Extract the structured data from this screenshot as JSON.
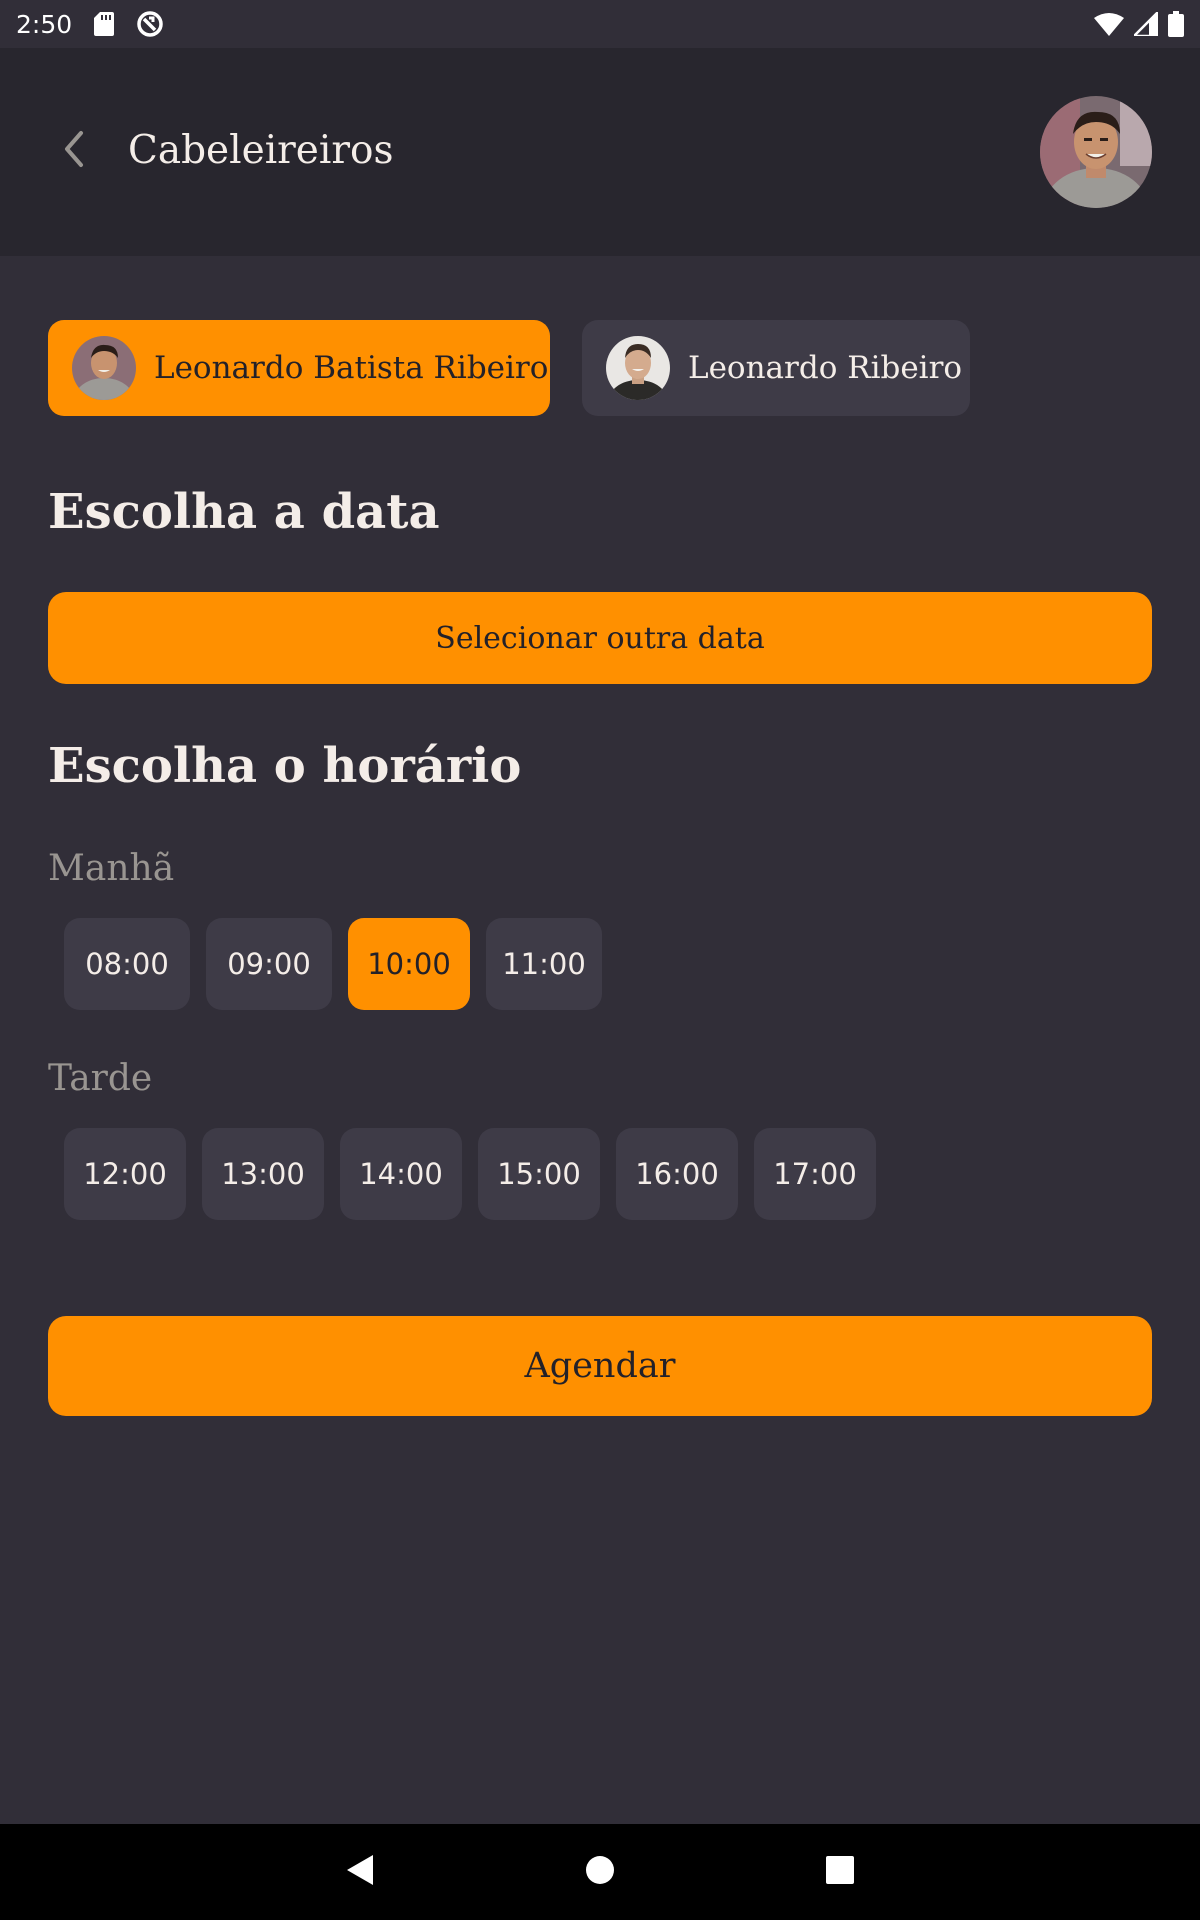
{
  "status_bar": {
    "time": "2:50",
    "icons": [
      "sd-card-icon",
      "sync-icon",
      "wifi-icon",
      "signal-icon",
      "battery-icon"
    ]
  },
  "header": {
    "back_icon": "chevron-left-icon",
    "title": "Cabeleireiros",
    "avatar": "user-avatar"
  },
  "providers": [
    {
      "name": "Leonardo Batista Ribeiro",
      "selected": true
    },
    {
      "name": "Leonardo Ribeiro",
      "selected": false
    }
  ],
  "date_section": {
    "title": "Escolha a data",
    "button_label": "Selecionar outra data"
  },
  "time_section": {
    "title": "Escolha o horário",
    "morning": {
      "label": "Manhã",
      "hours": [
        "08:00",
        "09:00",
        "10:00",
        "11:00"
      ],
      "selected": "10:00"
    },
    "afternoon": {
      "label": "Tarde",
      "hours": [
        "12:00",
        "13:00",
        "14:00",
        "15:00",
        "16:00",
        "17:00"
      ],
      "selected": ""
    }
  },
  "submit": {
    "label": "Agendar"
  },
  "colors": {
    "background": "#312e38",
    "header": "#28262e",
    "accent": "#ff9000",
    "chip": "#3e3b47",
    "muted_text": "#999591",
    "text": "#f4ede8"
  },
  "nav_bar": {
    "icons": [
      "nav-back-icon",
      "nav-home-icon",
      "nav-recents-icon"
    ]
  }
}
